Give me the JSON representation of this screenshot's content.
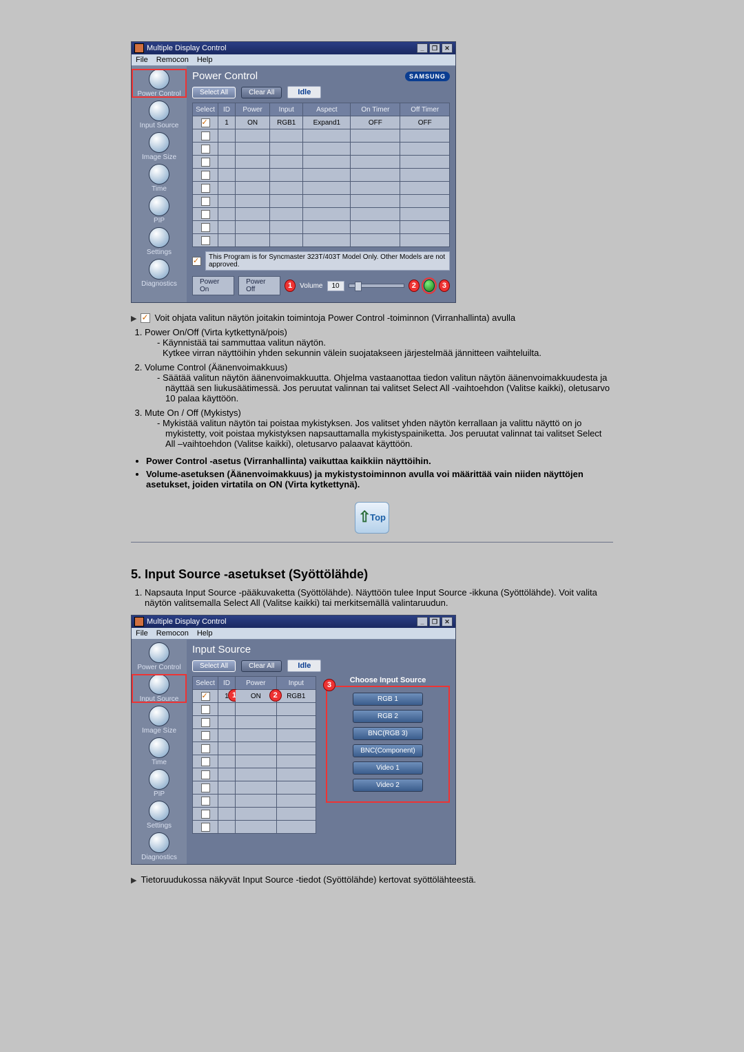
{
  "app_title": "Multiple Display Control",
  "menubar": [
    "File",
    "Remocon",
    "Help"
  ],
  "winbuttons": [
    "_",
    "❐",
    "✕"
  ],
  "sidebar": {
    "items": [
      {
        "label": "Power Control"
      },
      {
        "label": "Input Source"
      },
      {
        "label": "Image Size"
      },
      {
        "label": "Time"
      },
      {
        "label": "PIP"
      },
      {
        "label": "Settings"
      },
      {
        "label": "Diagnostics"
      }
    ]
  },
  "brand": "SAMSUNG",
  "btn_select_all": "Select All",
  "btn_clear_all": "Clear All",
  "idle_label": "Idle",
  "power": {
    "title": "Power Control",
    "headers": [
      "Select",
      "ID",
      "Power",
      "Input",
      "Aspect",
      "On Timer",
      "Off Timer"
    ],
    "row": {
      "id": "1",
      "power": "ON",
      "input": "RGB1",
      "aspect": "Expand1",
      "on": "OFF",
      "off": "OFF"
    },
    "note": "This Program is for Syncmaster 323T/403T Model Only. Other Models are not approved.",
    "power_on": "Power On",
    "power_off": "Power Off",
    "volume_label": "Volume",
    "volume_value": "10"
  },
  "desc1": {
    "lead": "Voit ohjata valitun näytön joitakin toimintoja Power Control -toiminnon (Virranhallinta) avulla",
    "n1": "Power On/Off (Virta kytkettynä/pois)",
    "n1a": "- Käynnistää tai sammuttaa valitun näytön.",
    "n1b": "Kytkee virran näyttöihin yhden sekunnin välein suojatakseen järjestelmää jännitteen vaihteluilta.",
    "n2": "Volume Control (Äänenvoimakkuus)",
    "n2a": "- Säätää valitun näytön äänenvoimakkuutta. Ohjelma vastaanottaa tiedon valitun näytön äänenvoimakkuudesta ja näyttää sen liukusäätimessä. Jos peruutat valinnan tai valitset Select All -vaihtoehdon (Valitse kaikki), oletusarvo 10 palaa käyttöön.",
    "n3": "Mute On / Off (Mykistys)",
    "n3a": "- Mykistää valitun näytön tai poistaa mykistyksen. Jos valitset yhden näytön kerrallaan ja valittu näyttö on jo mykistetty, voit poistaa mykistyksen napsauttamalla mykistyspainiketta. Jos peruutat valinnat tai valitset Select All –vaihtoehdon (Valitse kaikki), oletusarvo palaavat käyttöön.",
    "b1": "Power Control -asetus (Virranhallinta) vaikuttaa kaikkiin näyttöihin.",
    "b2": "Volume-asetuksen (Äänenvoimakkuus) ja mykistystoiminnon avulla voi määrittää vain niiden näyttöjen asetukset, joiden virtatila on ON (Virta kytkettynä)."
  },
  "section5": {
    "heading": "5. Input Source -asetukset (Syöttölähde)",
    "intro": "Napsauta Input Source -pääkuvaketta (Syöttölähde). Näyttöön tulee Input Source -ikkuna (Syöttölähde). Voit valita näytön valitsemalla Select All (Valitse kaikki) tai merkitsemällä valintaruudun."
  },
  "input": {
    "title": "Input Source",
    "headers": [
      "Select",
      "ID",
      "Power",
      "Input"
    ],
    "row": {
      "id": "1",
      "power": "ON",
      "input": "RGB1"
    },
    "choose_title": "Choose Input Source",
    "sources": [
      "RGB 1",
      "RGB 2",
      "BNC(RGB 3)",
      "BNC(Component)",
      "Video 1",
      "Video 2"
    ]
  },
  "desc2": {
    "line": "Tietoruudukossa näkyvät Input Source -tiedot (Syöttölähde) kertovat syöttölähteestä."
  }
}
